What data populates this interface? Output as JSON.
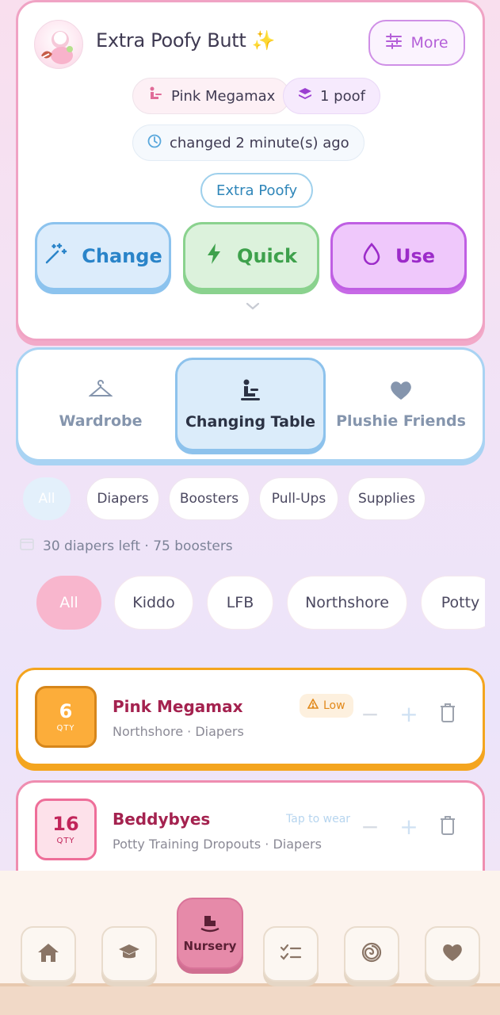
{
  "profile": {
    "title": "Extra Poofy Butt ✨",
    "more_label": "More",
    "diaper_chip": "Pink Megamax",
    "poof_chip": "1 poof",
    "changed_chip": "changed 2 minute(s) ago",
    "status": "Extra Poofy"
  },
  "actions": {
    "change": "Change",
    "quick": "Quick",
    "use": "Use"
  },
  "tabs": {
    "wardrobe": "Wardrobe",
    "changing": "Changing Table",
    "plushie": "Plushie Friends"
  },
  "filters": [
    "All",
    "Diapers",
    "Boosters",
    "Pull-Ups",
    "Supplies"
  ],
  "summary": "30 diapers left · 75 boosters",
  "brands": [
    "All",
    "Kiddo",
    "LFB",
    "Northshore",
    "Potty"
  ],
  "items": [
    {
      "qty": "6",
      "qty_label": "QTY",
      "name": "Pink Megamax",
      "sub": "Northshore · Diapers",
      "badge": "Low"
    },
    {
      "qty": "16",
      "qty_label": "QTY",
      "name": "Beddybyes",
      "sub": "Potty Training Dropouts · Diapers",
      "hint": "Tap to wear"
    }
  ],
  "nav": {
    "center_label": "Nursery"
  },
  "colors": {
    "pink_accent": "#f0a3c4",
    "blue_accent": "#8cc3ee",
    "green_accent": "#8ad28e",
    "purple_accent": "#bf5fe3",
    "orange_accent": "#f4a51f"
  }
}
